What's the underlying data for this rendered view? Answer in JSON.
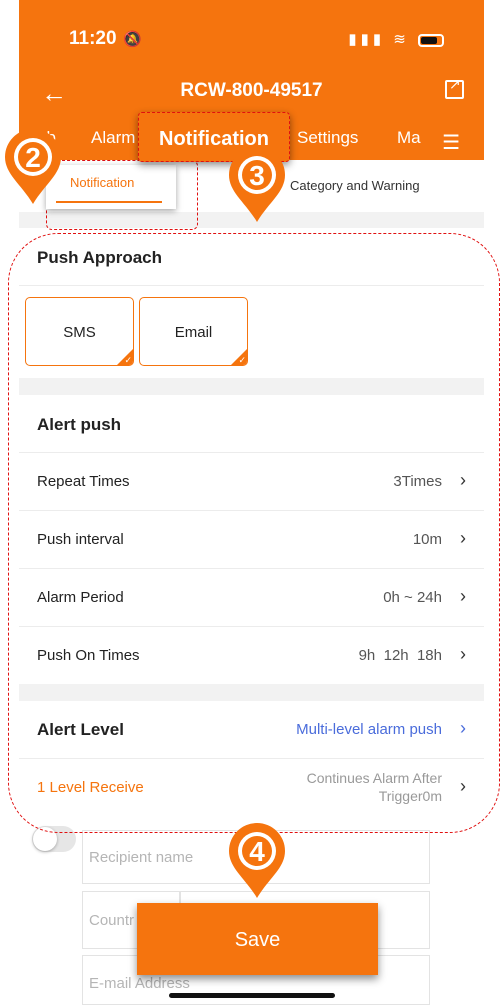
{
  "status_bar": {
    "time": "11:20"
  },
  "header": {
    "title": "RCW-800-49517"
  },
  "tabs": {
    "cut_label": "ab",
    "alarm_label": "Alarm",
    "active_label": "Notification",
    "settings_label": "Settings",
    "more_label": "Ma"
  },
  "subtabs": {
    "active_label": "Notification",
    "other_prefix": "Al",
    "other_label": "Category and Warning"
  },
  "push_approach": {
    "title": "Push Approach",
    "options": [
      "SMS",
      "Email"
    ]
  },
  "alert_push": {
    "title": "Alert push",
    "rows": [
      {
        "label": "Repeat Times",
        "value": "3Times"
      },
      {
        "label": "Push interval",
        "value": "10m"
      },
      {
        "label": "Alarm Period",
        "value": "0h ~ 24h"
      },
      {
        "label": "Push On Times",
        "value": "9h  12h  18h"
      }
    ]
  },
  "alert_level": {
    "title": "Alert Level",
    "link": "Multi-level alarm push",
    "receive_label": "1 Level Receive",
    "receive_value": "Continues Alarm After Trigger0m"
  },
  "form": {
    "recipient_placeholder": "Recipient name",
    "country_placeholder": "Countr",
    "email_placeholder": "E-mail Address"
  },
  "save_label": "Save",
  "markers": [
    "2",
    "3",
    "4"
  ],
  "colors": {
    "accent": "#f5740e",
    "link": "#4a6cdb",
    "annotation": "#e01010"
  }
}
